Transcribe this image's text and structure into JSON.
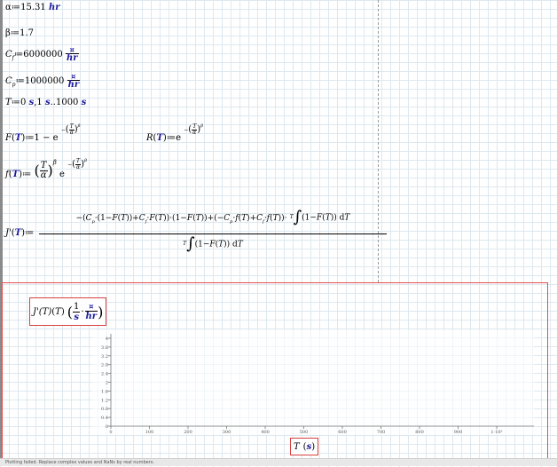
{
  "definitions": {
    "alpha": {
      "lhs": "α",
      "op": "≔",
      "value": "15.31",
      "unit": "hr"
    },
    "beta": {
      "lhs": "β",
      "op": "≔",
      "value": "1.7"
    },
    "cf": {
      "lhs": "C",
      "sub": "f",
      "op": "≔",
      "value": "6000000",
      "unit_num": "¤",
      "unit_den": "hr"
    },
    "cp": {
      "lhs": "C",
      "sub": "p",
      "op": "≔",
      "value": "1000000",
      "unit_num": "¤",
      "unit_den": "hr"
    },
    "t_range": {
      "lhs": "T",
      "op": "≔",
      "start": "0",
      "step": "1",
      "end": "1000",
      "unit": "s"
    }
  },
  "functions": {
    "F": {
      "name": "F",
      "arg": "T",
      "body": "1 − e"
    },
    "R": {
      "name": "R",
      "arg": "T",
      "body": "e"
    },
    "f": {
      "name": "f",
      "arg": "T",
      "body": "e"
    },
    "J": {
      "name": "J'",
      "arg": "T",
      "numerator": "−(Cp · (1−F(T)) + Cf · F(T)) · (1−F(T)) + (−Cp · f(T) + Cf · f(T)) · ∫₀ᵀ (1−F(T)) dT",
      "denominator": "∫₀ᵀ (1−F(T)) dT"
    }
  },
  "plot": {
    "y_axis_label": "J'(T)",
    "y_unit_num": "1",
    "y_unit_den": "s",
    "y_unit2_num": "¤",
    "y_unit2_den": "hr",
    "x_axis_label": "T",
    "x_unit": "s"
  },
  "chart_data": {
    "type": "line",
    "title": "",
    "xlabel": "T (s)",
    "ylabel": "J'(T) (1/s · ¤/hr)",
    "x_ticks": [
      "0",
      "100",
      "200",
      "300",
      "400",
      "500",
      "600",
      "700",
      "800",
      "900",
      "1·10³"
    ],
    "y_ticks": [
      "0",
      "0.4",
      "0.8",
      "1.2",
      "1.6",
      "2",
      "2.4",
      "2.8",
      "3.2",
      "3.6",
      "4"
    ],
    "xlim": [
      0,
      1000
    ],
    "ylim": [
      0,
      4
    ],
    "series": [],
    "grid": false
  },
  "status": {
    "message": "Plotting failed. Replace complex values and NaNs by real numbers."
  }
}
